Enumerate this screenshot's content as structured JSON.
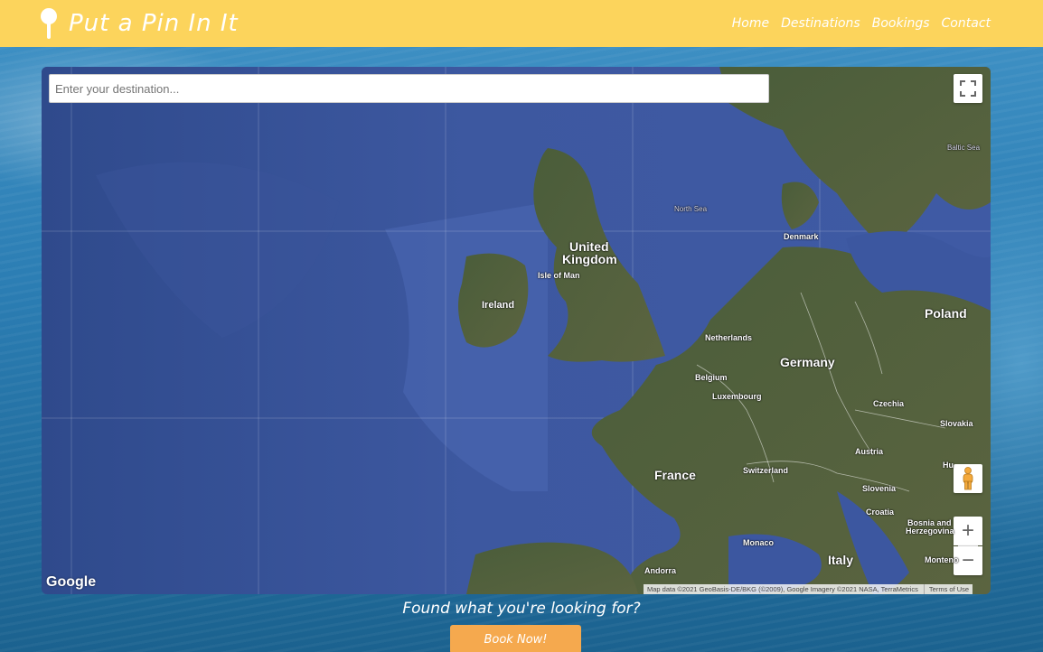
{
  "navbar": {
    "brand": "Put a Pin In It",
    "links": [
      "Home",
      "Destinations",
      "Bookings",
      "Contact"
    ],
    "background": "#fcd45c"
  },
  "map": {
    "search_placeholder": "Enter your destination...",
    "labels": {
      "united_kingdom_1": "United",
      "united_kingdom_2": "Kingdom",
      "isle_of_man": "Isle of Man",
      "ireland": "Ireland",
      "north_sea": "North Sea",
      "baltic_sea": "Baltic Sea",
      "denmark": "Denmark",
      "netherlands": "Netherlands",
      "germany": "Germany",
      "poland": "Poland",
      "belgium": "Belgium",
      "luxembourg": "Luxembourg",
      "czechia": "Czechia",
      "slovakia": "Slovakia",
      "austria": "Austria",
      "france": "France",
      "switzerland": "Switzerland",
      "slovenia": "Slovenia",
      "croatia": "Croatia",
      "bosnia_1": "Bosnia and",
      "bosnia_2": "Herzegovina",
      "monaco": "Monaco",
      "italy": "Italy",
      "andorra": "Andorra",
      "hungary": "Hu",
      "montenegro": "Monteno"
    },
    "google_logo": "Google",
    "attribution": "Map data ©2021 GeoBasis-DE/BKG (©2009), Google Imagery ©2021 NASA, TerraMetrics",
    "terms": "Terms of Use",
    "zoom_in": "+",
    "zoom_out": "−"
  },
  "cta": {
    "prompt": "Found what you're looking for?",
    "button": "Book Now!",
    "button_color": "#f5a94e"
  }
}
